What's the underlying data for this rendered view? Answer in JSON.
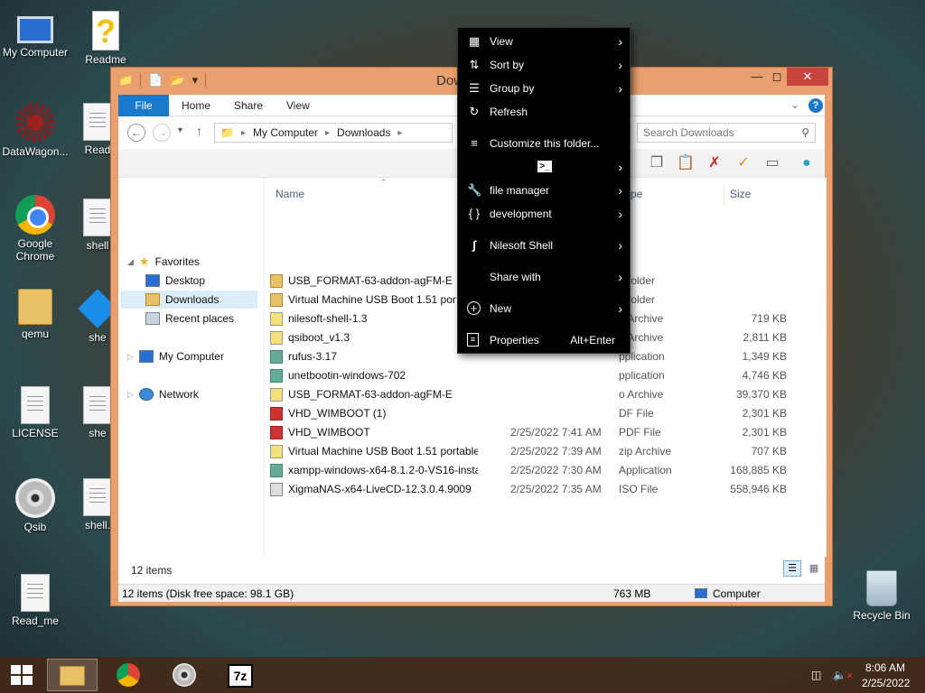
{
  "desktop": {
    "icons": [
      {
        "label": "My Computer"
      },
      {
        "label": "Readme"
      },
      {
        "label": "DataWagon..."
      },
      {
        "label": "Read"
      },
      {
        "label": "Google Chrome"
      },
      {
        "label": "shell"
      },
      {
        "label": "qemu"
      },
      {
        "label": "she"
      },
      {
        "label": "LICENSE"
      },
      {
        "label": "she"
      },
      {
        "label": "Qsib"
      },
      {
        "label": "shell."
      },
      {
        "label": "Read_me"
      },
      {
        "label": "Recycle Bin"
      }
    ]
  },
  "window": {
    "title": "Dow",
    "ribbon_tabs": [
      "File",
      "Home",
      "Share",
      "View"
    ],
    "address": {
      "crumbs": [
        "My Computer",
        "Downloads"
      ]
    },
    "search_placeholder": "Search Downloads",
    "nav": {
      "favorites": "Favorites",
      "desktop": "Desktop",
      "downloads": "Downloads",
      "recent": "Recent places",
      "my_computer": "My Computer",
      "network": "Network"
    },
    "columns": {
      "name": "Name",
      "type": "ype",
      "size": "Size"
    },
    "files": [
      {
        "name": "USB_FORMAT-63-addon-agFM-E",
        "date": "",
        "type": "e folder",
        "size": "",
        "icon": "folder"
      },
      {
        "name": "Virtual Machine USB Boot 1.51 por",
        "date": "",
        "type": "e folder",
        "size": "",
        "icon": "folder"
      },
      {
        "name": "nilesoft-shell-1.3",
        "date": "",
        "type": "o Archive",
        "size": "719 KB",
        "icon": "zip"
      },
      {
        "name": "qsiboot_v1.3",
        "date": "",
        "type": "o Archive",
        "size": "2,811 KB",
        "icon": "zip"
      },
      {
        "name": "rufus-3.17",
        "date": "",
        "type": "pplication",
        "size": "1,349 KB",
        "icon": "exe"
      },
      {
        "name": "unetbootin-windows-702",
        "date": "",
        "type": "pplication",
        "size": "4,746 KB",
        "icon": "exe"
      },
      {
        "name": "USB_FORMAT-63-addon-agFM-E",
        "date": "",
        "type": "o Archive",
        "size": "39,370 KB",
        "icon": "zip"
      },
      {
        "name": "VHD_WIMBOOT (1)",
        "date": "",
        "type": "DF File",
        "size": "2,301 KB",
        "icon": "pdf"
      },
      {
        "name": "VHD_WIMBOOT",
        "date": "2/25/2022 7:41 AM",
        "type": "PDF File",
        "size": "2,301 KB",
        "icon": "pdf"
      },
      {
        "name": "Virtual Machine USB Boot 1.51 portable",
        "date": "2/25/2022 7:39 AM",
        "type": "zip Archive",
        "size": "707 KB",
        "icon": "zip"
      },
      {
        "name": "xampp-windows-x64-8.1.2-0-VS16-installer",
        "date": "2/25/2022 7:30 AM",
        "type": "Application",
        "size": "168,885 KB",
        "icon": "exe"
      },
      {
        "name": "XigmaNAS-x64-LiveCD-12.3.0.4.9009",
        "date": "2/25/2022 7:35 AM",
        "type": "ISO File",
        "size": "558,946 KB",
        "icon": "iso"
      }
    ],
    "item_count": "12 items",
    "status_left": "12 items (Disk free space: 98.1 GB)",
    "status_mid": "763 MB",
    "status_right": "Computer"
  },
  "context_menu": {
    "items": [
      {
        "label": "View",
        "icon": "grid-icon"
      },
      {
        "label": "Sort by",
        "icon": "sort-icon"
      },
      {
        "label": "Group by",
        "icon": "list-icon"
      },
      {
        "label": "Refresh",
        "icon": "refresh-icon"
      },
      {
        "label": "Customize this folder...",
        "icon": "sliders-icon"
      },
      {
        "label": "",
        "icon": "terminal-icon"
      },
      {
        "label": "file manager",
        "icon": "wrench-icon"
      },
      {
        "label": "development",
        "icon": "braces-icon"
      },
      {
        "label": "Nilesoft Shell",
        "icon": "nilesoft-icon"
      },
      {
        "label": "Share with",
        "icon": ""
      },
      {
        "label": "New",
        "icon": "plus-circle-icon"
      },
      {
        "label": "Properties",
        "icon": "properties-icon",
        "accel": "Alt+Enter"
      }
    ]
  },
  "taskbar": {
    "time": "8:06 AM",
    "date": "2/25/2022"
  }
}
